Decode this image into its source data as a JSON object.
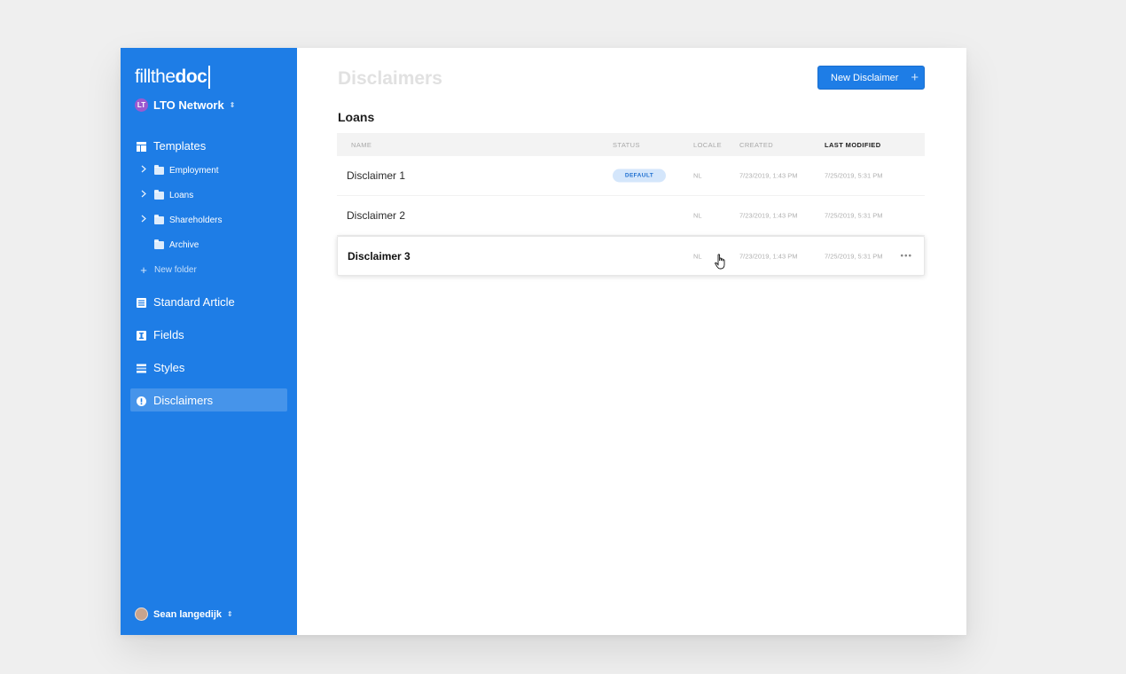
{
  "brand": {
    "logo_light": "fillthe",
    "logo_bold": "doc"
  },
  "workspace": {
    "avatar_text": "LT",
    "name": "LTO Network",
    "switch_glyph": "⇕"
  },
  "sidebar": {
    "templates_label": "Templates",
    "folders": [
      {
        "label": "Employment",
        "expandable": true
      },
      {
        "label": "Loans",
        "expandable": true
      },
      {
        "label": "Shareholders",
        "expandable": true
      },
      {
        "label": "Archive",
        "expandable": false
      }
    ],
    "new_folder_label": "New folder",
    "items": [
      {
        "label": "Standard Article",
        "icon": "article-icon"
      },
      {
        "label": "Fields",
        "icon": "field-icon"
      },
      {
        "label": "Styles",
        "icon": "styles-icon"
      },
      {
        "label": "Disclaimers",
        "icon": "exclamation-icon",
        "active": true
      }
    ],
    "user_name": "Sean langedijk"
  },
  "main": {
    "page_title": "Disclaimers",
    "new_button_label": "New Disclaimer",
    "section_title": "Loans",
    "columns": [
      "NAME",
      "STATUS",
      "LOCALE",
      "CREATED",
      "LAST MODIFIED"
    ],
    "rows": [
      {
        "name": "Disclaimer 1",
        "status": "DEFAULT",
        "locale": "NL",
        "created": "7/23/2019, 1:43 PM",
        "modified": "7/25/2019, 5:31 PM"
      },
      {
        "name": "Disclaimer 2",
        "status": "",
        "locale": "NL",
        "created": "7/23/2019, 1:43 PM",
        "modified": "7/25/2019, 5:31 PM"
      },
      {
        "name": "Disclaimer 3",
        "status": "",
        "locale": "NL",
        "created": "7/23/2019, 1:43 PM",
        "modified": "7/25/2019, 5:31 PM"
      }
    ],
    "row_menu_glyph": "•••"
  },
  "colors": {
    "accent": "#1e7de6",
    "badge_bg": "#d4e6fb"
  }
}
